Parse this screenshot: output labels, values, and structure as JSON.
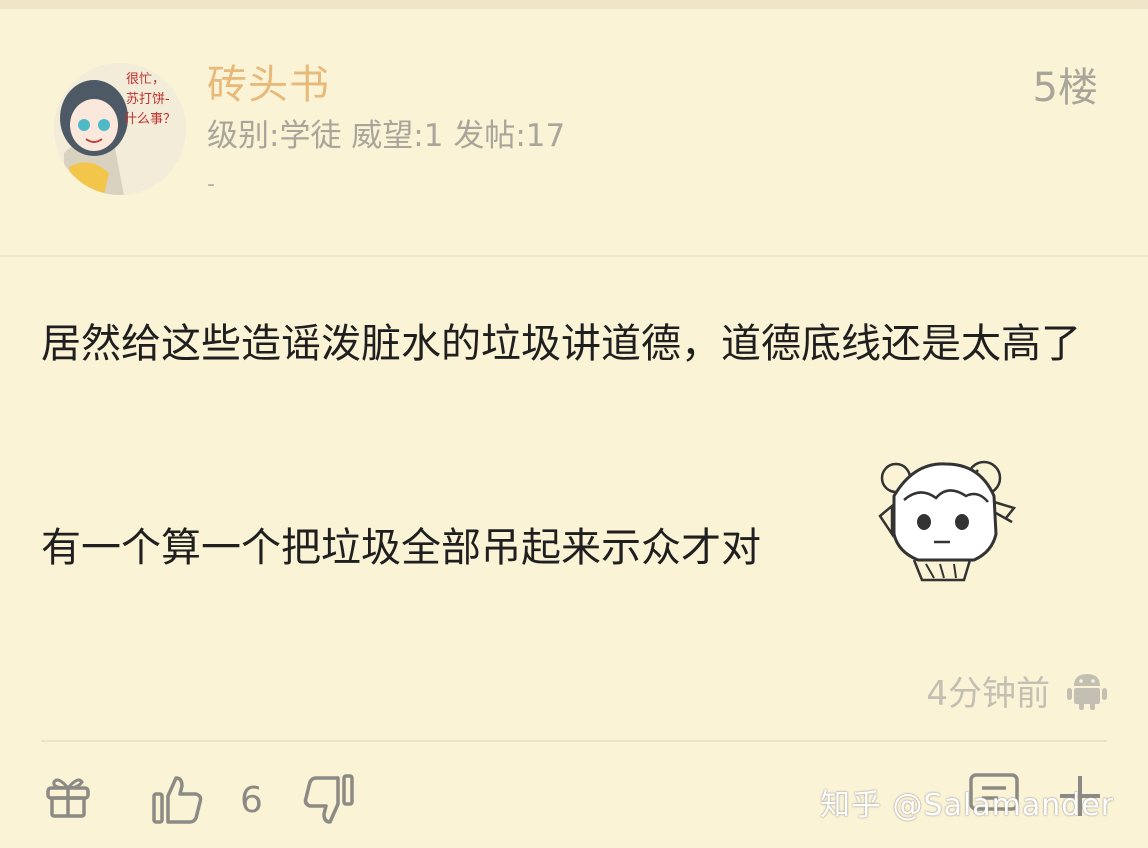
{
  "post": {
    "username": "砖头书",
    "user_info": "级别:学徒  威望:1  发帖:17",
    "signature": "-",
    "floor": "5楼",
    "content_lines": [
      "居然给这些造谣泼脏水的垃圾讲道德，道德底线还是太高了",
      "有一个算一个把垃圾全部吊起来示众才对"
    ],
    "time": "4分钟前",
    "likes": "6"
  },
  "avatar_text": [
    "很忙，",
    "苏打饼-",
    "什么事？"
  ],
  "icons": {
    "avatar": "avatar-anime-girl",
    "sticker": "anime-girl-sticker",
    "device": "android-icon",
    "gift": "gift-icon",
    "like": "thumbs-up-icon",
    "dislike": "thumbs-down-icon",
    "comment": "comment-icon",
    "more": "plus-icon"
  },
  "watermark": "知乎 @Salamander",
  "colors": {
    "background": "#fbf3d6",
    "username": "#e7b97b",
    "meta": "#a9a59a",
    "text": "#1f1f1f"
  }
}
